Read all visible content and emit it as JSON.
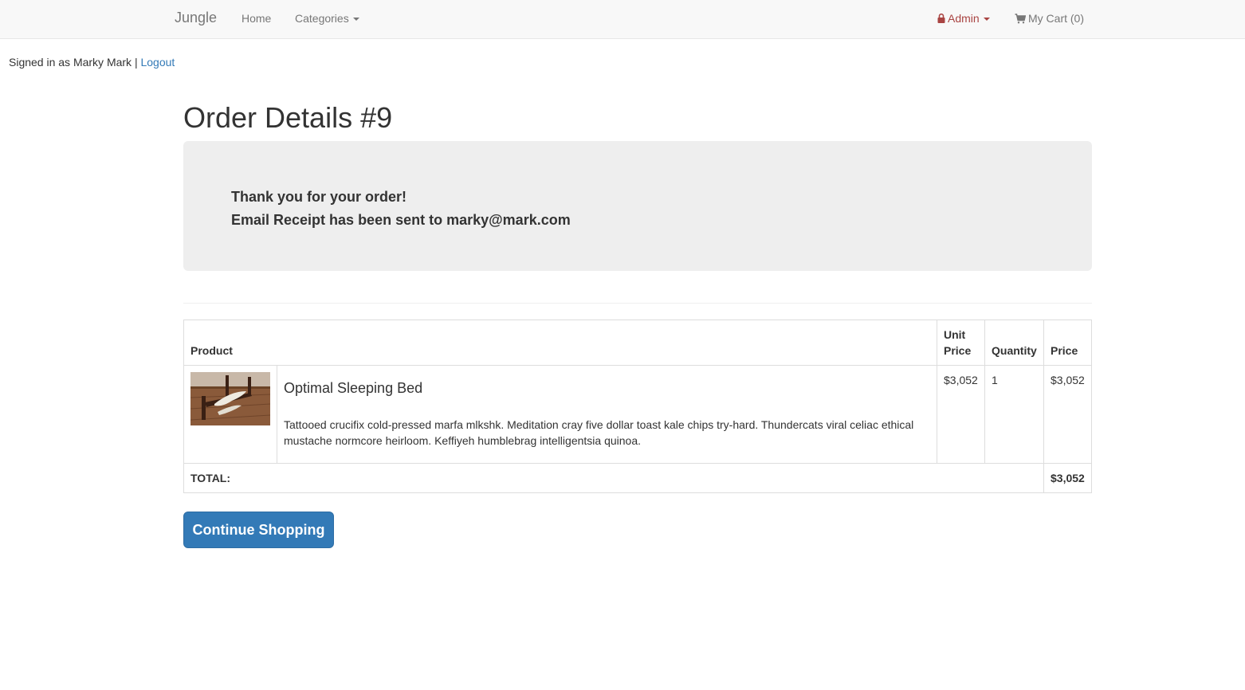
{
  "nav": {
    "brand": "Jungle",
    "home": "Home",
    "categories": "Categories",
    "admin": "Admin",
    "cart": "My Cart (0)"
  },
  "session": {
    "signed_in_text": "Signed in as Marky Mark |",
    "logout": "Logout"
  },
  "page": {
    "title": "Order Details #9"
  },
  "notice": {
    "line1": "Thank you for your order!",
    "line2": "Email Receipt has been sent to marky@mark.com"
  },
  "table": {
    "headers": {
      "product": "Product",
      "unit_price": "Unit Price",
      "quantity": "Quantity",
      "price": "Price"
    },
    "rows": [
      {
        "name": "Optimal Sleeping Bed",
        "description": "Tattooed crucifix cold-pressed marfa mlkshk. Meditation cray five dollar toast kale chips try-hard. Thundercats viral celiac ethical mustache normcore heirloom. Keffiyeh humblebrag intelligentsia quinoa.",
        "unit_price": "$3,052",
        "quantity": "1",
        "price": "$3,052"
      }
    ],
    "total_label": "TOTAL:",
    "total_value": "$3,052"
  },
  "actions": {
    "continue": "Continue Shopping"
  },
  "icons": {
    "lock": "lock-icon",
    "cart": "shopping-cart-icon",
    "caret": "caret-down-icon",
    "product_image": "bed-photo"
  },
  "colors": {
    "link": "#337ab7",
    "admin": "#a94442",
    "button": "#337ab7"
  }
}
